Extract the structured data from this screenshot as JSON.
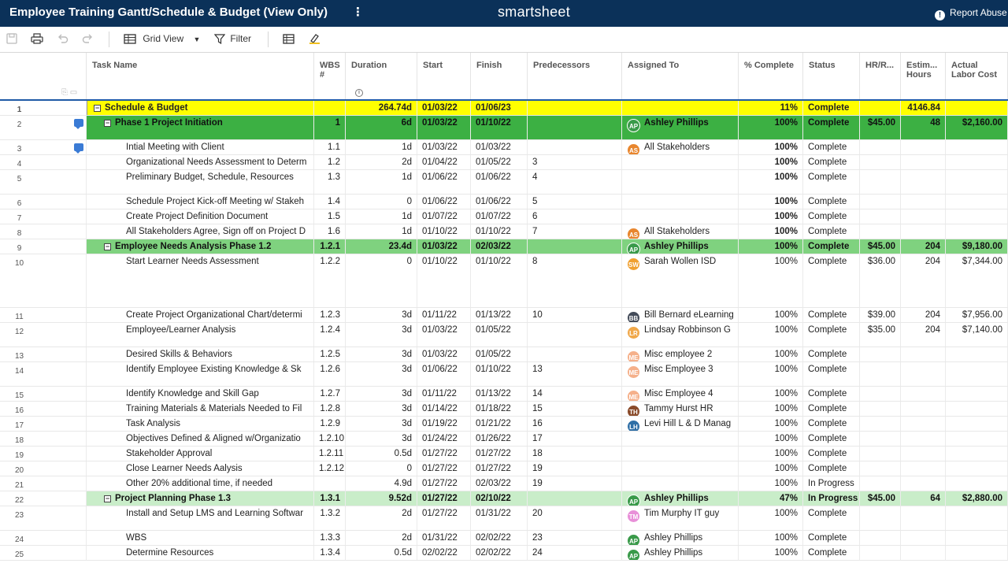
{
  "titlebar": {
    "title": "Employee Training Gantt/Schedule & Budget (View Only)",
    "kebab": "⋮",
    "brand": "smartsheet",
    "report": "Report Abuse"
  },
  "toolbar": {
    "grid_view": "Grid View",
    "filter": "Filter"
  },
  "columns": {
    "task": "Task Name",
    "wbs": "WBS #",
    "duration": "Duration",
    "start": "Start",
    "finish": "Finish",
    "predecessors": "Predecessors",
    "assigned": "Assigned To",
    "pct": "% Complete",
    "status": "Status",
    "hr": "HR/R...",
    "est": "Estim... Hours",
    "cost": "Actual Labor Cost"
  },
  "colors": {
    "header_bg": "#0b3159",
    "summary_yellow": "#ffff00",
    "phase1_green": "#3cb043",
    "phase2_green": "#7fd27f",
    "phase3_green": "#c9edc9"
  },
  "rows": [
    {
      "n": "1",
      "task": "Schedule & Budget",
      "wbs": "",
      "dur": "264.74d",
      "start": "01/03/22",
      "fin": "01/06/23",
      "pred": "",
      "asg": "",
      "av": "",
      "avc": "",
      "pct": "11%",
      "stat": "Complete",
      "hr": "",
      "est": "4146.84",
      "cost": ""
    },
    {
      "n": "2",
      "task": "Phase 1 Project Initiation",
      "wbs": "1",
      "dur": "6d",
      "start": "01/03/22",
      "fin": "01/10/22",
      "pred": "",
      "asg": "Ashley Phillips",
      "av": "AP",
      "avc": "#3a9a4a",
      "pct": "100%",
      "stat": "Complete",
      "hr": "$45.00",
      "est": "48",
      "cost": "$2,160.00"
    },
    {
      "n": "3",
      "task": "Intial Meeting with Client",
      "wbs": "1.1",
      "dur": "1d",
      "start": "01/03/22",
      "fin": "01/03/22",
      "pred": "",
      "asg": "All Stakeholders",
      "av": "AS",
      "avc": "#e8862e",
      "pct": "100%",
      "stat": "Complete",
      "hr": "",
      "est": "",
      "cost": ""
    },
    {
      "n": "4",
      "task": "Organizational Needs Assessment to Determ",
      "wbs": "1.2",
      "dur": "2d",
      "start": "01/04/22",
      "fin": "01/05/22",
      "pred": "3",
      "asg": "",
      "av": "",
      "avc": "",
      "pct": "100%",
      "stat": "Complete",
      "hr": "",
      "est": "",
      "cost": ""
    },
    {
      "n": "5",
      "task": "Preliminary Budget, Schedule, Resources",
      "wbs": "1.3",
      "dur": "1d",
      "start": "01/06/22",
      "fin": "01/06/22",
      "pred": "4",
      "asg": "",
      "av": "",
      "avc": "",
      "pct": "100%",
      "stat": "Complete",
      "hr": "",
      "est": "",
      "cost": ""
    },
    {
      "n": "6",
      "task": "Schedule Project Kick-off Meeting w/ Stakeh",
      "wbs": "1.4",
      "dur": "0",
      "start": "01/06/22",
      "fin": "01/06/22",
      "pred": "5",
      "asg": "",
      "av": "",
      "avc": "",
      "pct": "100%",
      "stat": "Complete",
      "hr": "",
      "est": "",
      "cost": ""
    },
    {
      "n": "7",
      "task": "Create Project Definition Document",
      "wbs": "1.5",
      "dur": "1d",
      "start": "01/07/22",
      "fin": "01/07/22",
      "pred": "6",
      "asg": "",
      "av": "",
      "avc": "",
      "pct": "100%",
      "stat": "Complete",
      "hr": "",
      "est": "",
      "cost": ""
    },
    {
      "n": "8",
      "task": "All Stakeholders Agree, Sign off on Project D",
      "wbs": "1.6",
      "dur": "1d",
      "start": "01/10/22",
      "fin": "01/10/22",
      "pred": "7",
      "asg": "All Stakeholders",
      "av": "AS",
      "avc": "#e8862e",
      "pct": "100%",
      "stat": "Complete",
      "hr": "",
      "est": "",
      "cost": ""
    },
    {
      "n": "9",
      "task": "Employee Needs Analysis Phase 1.2",
      "wbs": "1.2.1",
      "dur": "23.4d",
      "start": "01/03/22",
      "fin": "02/03/22",
      "pred": "",
      "asg": "Ashley Phillips",
      "av": "AP",
      "avc": "#3a9a4a",
      "pct": "100%",
      "stat": "Complete",
      "hr": "$45.00",
      "est": "204",
      "cost": "$9,180.00"
    },
    {
      "n": "10",
      "task": "Start Learner Needs Assessment",
      "wbs": "1.2.2",
      "dur": "0",
      "start": "01/10/22",
      "fin": "01/10/22",
      "pred": "8",
      "asg": "Sarah Wollen ISD",
      "av": "SW",
      "avc": "#f0a030",
      "pct": "100%",
      "stat": "Complete",
      "hr": "$36.00",
      "est": "204",
      "cost": "$7,344.00"
    },
    {
      "n": "11",
      "task": "Create Project Organizational Chart/determi",
      "wbs": "1.2.3",
      "dur": "3d",
      "start": "01/11/22",
      "fin": "01/13/22",
      "pred": "10",
      "asg": "Bill Bernard eLearning",
      "av": "BB",
      "avc": "#444c5a",
      "pct": "100%",
      "stat": "Complete",
      "hr": "$39.00",
      "est": "204",
      "cost": "$7,956.00"
    },
    {
      "n": "12",
      "task": "Employee/Learner Analysis",
      "wbs": "1.2.4",
      "dur": "3d",
      "start": "01/03/22",
      "fin": "01/05/22",
      "pred": "",
      "asg": "Lindsay Robbinson G",
      "av": "LR",
      "avc": "#f0a84a",
      "pct": "100%",
      "stat": "Complete",
      "hr": "$35.00",
      "est": "204",
      "cost": "$7,140.00"
    },
    {
      "n": "13",
      "task": "Desired Skills & Behaviors",
      "wbs": "1.2.5",
      "dur": "3d",
      "start": "01/03/22",
      "fin": "01/05/22",
      "pred": "",
      "asg": "Misc employee 2",
      "av": "ME",
      "avc": "#f5b08a",
      "pct": "100%",
      "stat": "Complete",
      "hr": "",
      "est": "",
      "cost": ""
    },
    {
      "n": "14",
      "task": "Identify Employee Existing Knowledge & Sk",
      "wbs": "1.2.6",
      "dur": "3d",
      "start": "01/06/22",
      "fin": "01/10/22",
      "pred": "13",
      "asg": "Misc Employee 3",
      "av": "ME",
      "avc": "#f5b08a",
      "pct": "100%",
      "stat": "Complete",
      "hr": "",
      "est": "",
      "cost": ""
    },
    {
      "n": "15",
      "task": "Identify Knowledge and Skill Gap",
      "wbs": "1.2.7",
      "dur": "3d",
      "start": "01/11/22",
      "fin": "01/13/22",
      "pred": "14",
      "asg": "Misc Employee 4",
      "av": "ME",
      "avc": "#f5b08a",
      "pct": "100%",
      "stat": "Complete",
      "hr": "",
      "est": "",
      "cost": ""
    },
    {
      "n": "16",
      "task": "Training Materials & Materials Needed to Fil",
      "wbs": "1.2.8",
      "dur": "3d",
      "start": "01/14/22",
      "fin": "01/18/22",
      "pred": "15",
      "asg": "Tammy Hurst HR",
      "av": "TH",
      "avc": "#8a4b2a",
      "pct": "100%",
      "stat": "Complete",
      "hr": "",
      "est": "",
      "cost": ""
    },
    {
      "n": "17",
      "task": "Task Analysis",
      "wbs": "1.2.9",
      "dur": "3d",
      "start": "01/19/22",
      "fin": "01/21/22",
      "pred": "16",
      "asg": "Levi Hill L & D Manag",
      "av": "LH",
      "avc": "#2f6fa6",
      "pct": "100%",
      "stat": "Complete",
      "hr": "",
      "est": "",
      "cost": ""
    },
    {
      "n": "18",
      "task": "Objectives Defined & Aligned w/Organizatio",
      "wbs": "1.2.10",
      "dur": "3d",
      "start": "01/24/22",
      "fin": "01/26/22",
      "pred": "17",
      "asg": "",
      "av": "",
      "avc": "",
      "pct": "100%",
      "stat": "Complete",
      "hr": "",
      "est": "",
      "cost": ""
    },
    {
      "n": "19",
      "task": "Stakeholder Approval",
      "wbs": "1.2.11",
      "dur": "0.5d",
      "start": "01/27/22",
      "fin": "01/27/22",
      "pred": "18",
      "asg": "",
      "av": "",
      "avc": "",
      "pct": "100%",
      "stat": "Complete",
      "hr": "",
      "est": "",
      "cost": ""
    },
    {
      "n": "20",
      "task": "Close Learner Needs Aalysis",
      "wbs": "1.2.12",
      "dur": "0",
      "start": "01/27/22",
      "fin": "01/27/22",
      "pred": "19",
      "asg": "",
      "av": "",
      "avc": "",
      "pct": "100%",
      "stat": "Complete",
      "hr": "",
      "est": "",
      "cost": ""
    },
    {
      "n": "21",
      "task": "Other 20% additional time, if needed",
      "wbs": "",
      "dur": "4.9d",
      "start": "01/27/22",
      "fin": "02/03/22",
      "pred": "19",
      "asg": "",
      "av": "",
      "avc": "",
      "pct": "100%",
      "stat": "In Progress",
      "hr": "",
      "est": "",
      "cost": ""
    },
    {
      "n": "22",
      "task": "Project Planning Phase 1.3",
      "wbs": "1.3.1",
      "dur": "9.52d",
      "start": "01/27/22",
      "fin": "02/10/22",
      "pred": "",
      "asg": "Ashley Phillips",
      "av": "AP",
      "avc": "#3a9a4a",
      "pct": "47%",
      "stat": "In Progress",
      "hr": "$45.00",
      "est": "64",
      "cost": "$2,880.00"
    },
    {
      "n": "23",
      "task": "Install and Setup LMS and Learning Softwar",
      "wbs": "1.3.2",
      "dur": "2d",
      "start": "01/27/22",
      "fin": "01/31/22",
      "pred": "20",
      "asg": "Tim Murphy IT guy",
      "av": "TM",
      "avc": "#e890d8",
      "pct": "100%",
      "stat": "Complete",
      "hr": "",
      "est": "",
      "cost": ""
    },
    {
      "n": "24",
      "task": "WBS",
      "wbs": "1.3.3",
      "dur": "2d",
      "start": "01/31/22",
      "fin": "02/02/22",
      "pred": "23",
      "asg": "Ashley Phillips",
      "av": "AP",
      "avc": "#3a9a4a",
      "pct": "100%",
      "stat": "Complete",
      "hr": "",
      "est": "",
      "cost": ""
    },
    {
      "n": "25",
      "task": "Determine Resources",
      "wbs": "1.3.4",
      "dur": "0.5d",
      "start": "02/02/22",
      "fin": "02/02/22",
      "pred": "24",
      "asg": "Ashley Phillips",
      "av": "AP",
      "avc": "#3a9a4a",
      "pct": "100%",
      "stat": "Complete",
      "hr": "",
      "est": "",
      "cost": ""
    }
  ]
}
